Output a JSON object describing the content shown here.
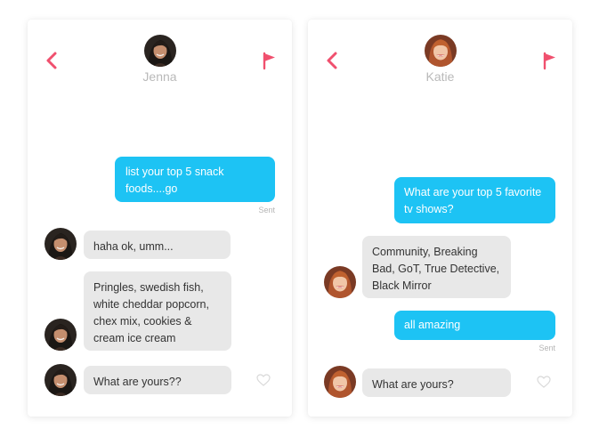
{
  "colors": {
    "accent_red": "#f0506e",
    "sent_bubble": "#1dc3f4",
    "received_bubble": "#e8e8e8",
    "muted_text": "#b9b9b9"
  },
  "chats": [
    {
      "contact_name": "Jenna",
      "icons": [
        "chevron-left-icon",
        "flag-icon",
        "heart-icon"
      ],
      "messages": [
        {
          "from": "me",
          "text": "list your top 5 snack foods....go",
          "status": "Sent"
        },
        {
          "from": "them",
          "text": "haha ok, umm..."
        },
        {
          "from": "them",
          "text": "Pringles, swedish fish, white cheddar popcorn, chex mix, cookies & cream ice cream"
        },
        {
          "from": "them",
          "text": "What are yours??"
        }
      ]
    },
    {
      "contact_name": "Katie",
      "icons": [
        "chevron-left-icon",
        "flag-icon",
        "heart-icon"
      ],
      "messages": [
        {
          "from": "me",
          "text": "What are your top 5 favorite tv shows?"
        },
        {
          "from": "them",
          "text": "Community, Breaking Bad, GoT, True Detective, Black Mirror"
        },
        {
          "from": "me",
          "text": "all amazing",
          "status": "Sent"
        },
        {
          "from": "them",
          "text": "What are yours?"
        }
      ]
    }
  ]
}
